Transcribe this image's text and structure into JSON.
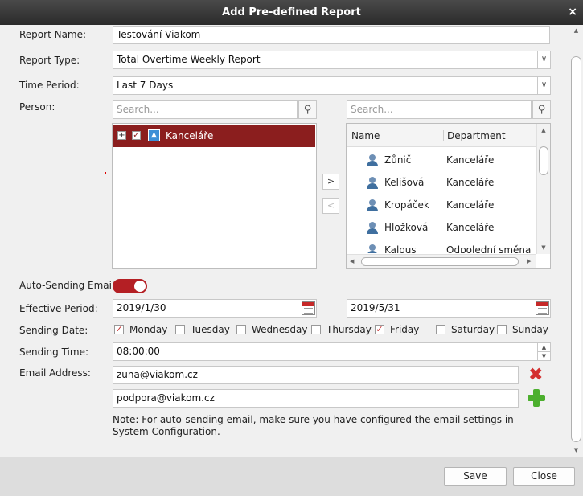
{
  "dialog": {
    "title": "Add Pre-defined Report",
    "close_glyph": "×"
  },
  "labels": {
    "report_name": "Report Name:",
    "report_type": "Report Type:",
    "time_period": "Time Period:",
    "person": "Person:",
    "auto_sending": "Auto-Sending Email",
    "effective_period": "Effective Period:",
    "sending_date": "Sending Date:",
    "sending_time": "Sending Time:",
    "email_address": "Email Address:"
  },
  "fields": {
    "report_name": "Testování Viakom",
    "report_type": "Total Overtime Weekly Report",
    "time_period": "Last 7 Days",
    "search_left_placeholder": "Search...",
    "search_right_placeholder": "Search...",
    "effective_start": "2019/1/30",
    "effective_end": "2019/5/31",
    "sending_time": "08:00:00",
    "emails": [
      "zuna@viakom.cz",
      "podpora@viakom.cz"
    ]
  },
  "tree": {
    "selected_item": "Kanceláře",
    "expand_glyph": "+",
    "check_glyph": "✓"
  },
  "move_buttons": {
    "add": ">",
    "remove": "<"
  },
  "person_list": {
    "columns": [
      "Name",
      "Department"
    ],
    "rows": [
      {
        "name": "Zůnič",
        "department": "Kanceláře"
      },
      {
        "name": "Kelišová",
        "department": "Kanceláře"
      },
      {
        "name": "Kropáček",
        "department": "Kanceláře"
      },
      {
        "name": "Hložková",
        "department": "Kanceláře"
      },
      {
        "name": "Kalous",
        "department": "Odpolední směna"
      }
    ]
  },
  "auto_sending_enabled": true,
  "sending_days": [
    {
      "label": "Monday",
      "checked": true
    },
    {
      "label": "Tuesday",
      "checked": false
    },
    {
      "label": "Wednesday",
      "checked": false
    },
    {
      "label": "Thursday",
      "checked": false
    },
    {
      "label": "Friday",
      "checked": true
    },
    {
      "label": "Saturday",
      "checked": false
    },
    {
      "label": "Sunday",
      "checked": false
    }
  ],
  "note": "Note: For auto-sending email, make sure you have configured the email settings in System Configuration.",
  "buttons": {
    "save": "Save",
    "close": "Close"
  },
  "colors": {
    "accent": "#b41f24",
    "selected_row": "#8b1e1e",
    "delete": "#d32f2f",
    "add": "#4caf2e"
  }
}
